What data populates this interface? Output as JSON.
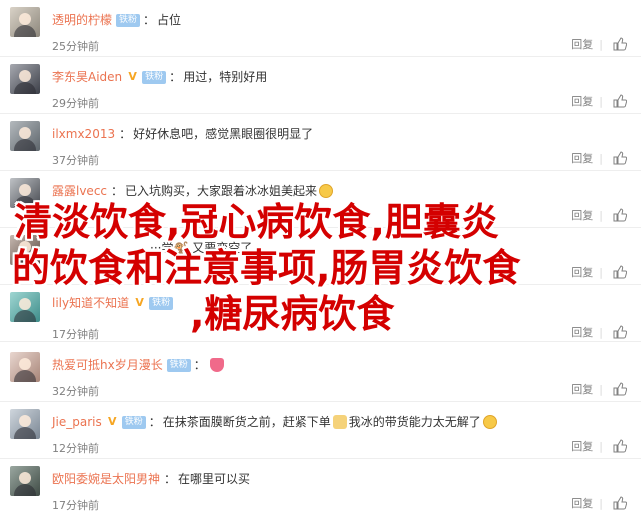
{
  "comments": [
    {
      "name": "透明的柠檬",
      "v": false,
      "fan": "铁粉",
      "text": "占位",
      "emoji": [],
      "time": "25分钟前",
      "reply": "回复"
    },
    {
      "name": "李东昊Aiden",
      "v": true,
      "fan": "铁粉",
      "text": "用过，特别好用",
      "emoji": [],
      "time": "29分钟前",
      "reply": "回复"
    },
    {
      "name": "ilxmx2013",
      "v": false,
      "fan": "",
      "text": "好好休息吧，感觉黑眼圈很明显了",
      "emoji": [],
      "time": "37分钟前",
      "reply": "回复"
    },
    {
      "name": "露露lvecc",
      "v": false,
      "fan": "",
      "text": "已入坑购买，大家跟着冰冰姐美起来",
      "emoji": [
        "grin-emoji"
      ],
      "time": "",
      "reply": "回复"
    },
    {
      "name": "",
      "v": false,
      "fan": "",
      "text": "···学🐒 又要变空了",
      "emoji": [],
      "time": "",
      "reply": "回复"
    },
    {
      "name": "lily知道不知道",
      "v": true,
      "fan": "铁粉",
      "text": "",
      "emoji": [],
      "time": "17分钟前",
      "reply": "回复"
    },
    {
      "name": "热爱可抵hx岁月漫长",
      "v": false,
      "fan": "铁粉",
      "text": "",
      "emoji": [
        "heart-emoji"
      ],
      "time": "32分钟前",
      "reply": "回复"
    },
    {
      "name": "Jie_paris",
      "v": true,
      "fan": "铁粉",
      "text": "在抹茶面膜断货之前，赶紧下单",
      "text2": "我冰的带货能力太无解了",
      "emoji": [
        "cat-emoji",
        "smile-emoji"
      ],
      "time": "12分钟前",
      "reply": "回复"
    },
    {
      "name": "欧阳委婉是太阳男神",
      "v": false,
      "fan": "",
      "text": "在哪里可以买",
      "emoji": [],
      "time": "17分钟前",
      "reply": "回复"
    }
  ],
  "overlay": {
    "line1": "清淡饮食,冠心病饮食,胆囊炎",
    "line2": "的饮食和注意事项,肠胃炎饮食",
    "line3": ",糖尿病饮食"
  },
  "colors": {
    "username": "#eb7350",
    "overlay_text": "#d40000",
    "fan_badge": "#9ec9f0"
  }
}
